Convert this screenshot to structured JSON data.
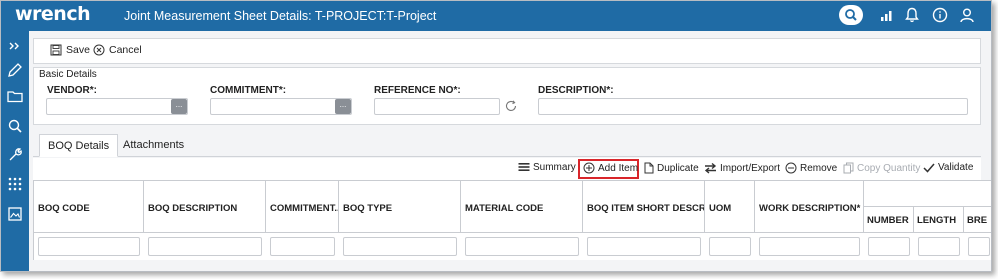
{
  "app": {
    "logo_text": "wrench",
    "window_title": "Joint Measurement Sheet Details: T-PROJECT:T-Project"
  },
  "toolbar": {
    "save_label": "Save",
    "cancel_label": "Cancel"
  },
  "basic_details": {
    "legend": "Basic Details",
    "fields": [
      {
        "label": "VENDOR*:",
        "value": ""
      },
      {
        "label": "COMMITMENT*:",
        "value": ""
      },
      {
        "label": "REFERENCE NO*:",
        "value": ""
      },
      {
        "label": "DESCRIPTION*:",
        "value": ""
      }
    ],
    "lookup_label": "..."
  },
  "tabs": [
    {
      "label": "BOQ Details",
      "active": true
    },
    {
      "label": "Attachments",
      "active": false
    }
  ],
  "actions": {
    "summary": "Summary",
    "add_item": "Add Item",
    "duplicate": "Duplicate",
    "import_export": "Import/Export",
    "remove": "Remove",
    "copy_quantity": "Copy Quantity",
    "validate": "Validate"
  },
  "grid": {
    "columns": [
      "BOQ CODE",
      "BOQ DESCRIPTION",
      "COMMITMENT...",
      "BOQ TYPE",
      "MATERIAL CODE",
      "BOQ ITEM SHORT DESCRIP...",
      "UOM",
      "WORK DESCRIPTION*"
    ],
    "sub_columns": [
      "NUMBER",
      "LENGTH",
      "BRE"
    ]
  },
  "colors": {
    "brand": "#1f6ba5",
    "highlight": "#d9252a"
  }
}
